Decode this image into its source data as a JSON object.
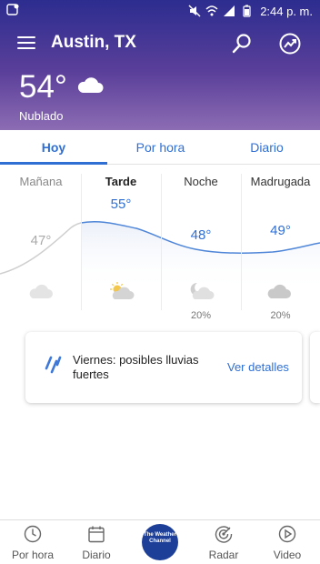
{
  "status_bar": {
    "time": "2:44 p. m."
  },
  "header": {
    "location": "Austin, TX",
    "temperature": "54°",
    "condition": "Nublado",
    "gradient_top": "#2c2d8f",
    "gradient_bottom": "#8c6cb3"
  },
  "tabs": [
    {
      "label": "Hoy",
      "active": true
    },
    {
      "label": "Por hora",
      "active": false
    },
    {
      "label": "Diario",
      "active": false
    }
  ],
  "forecast": [
    {
      "period": "Mañana",
      "temp": "47°",
      "icon": "cloud-icon",
      "precip": "",
      "current": false,
      "past": true
    },
    {
      "period": "Tarde",
      "temp": "55°",
      "icon": "partly-cloudy-day-icon",
      "precip": "",
      "current": true,
      "past": false
    },
    {
      "period": "Noche",
      "temp": "48°",
      "icon": "partly-cloudy-night-icon",
      "precip": "20%",
      "current": false,
      "past": false
    },
    {
      "period": "Madrugada",
      "temp": "49°",
      "icon": "cloud-icon",
      "precip": "20%",
      "current": false,
      "past": false
    }
  ],
  "alert": {
    "icon": "rain-icon",
    "text": "Viernes: posibles lluvias fuertes",
    "link": "Ver detalles"
  },
  "bottom_nav": {
    "items": [
      {
        "label": "Por hora",
        "icon": "clock-icon"
      },
      {
        "label": "Diario",
        "icon": "calendar-icon"
      },
      {
        "label": "Radar",
        "icon": "radar-icon"
      },
      {
        "label": "Video",
        "icon": "play-icon"
      }
    ],
    "logo_text": "The Weather Channel"
  },
  "colors": {
    "accent": "#2f6fd4",
    "muted": "#aaaaaa"
  }
}
